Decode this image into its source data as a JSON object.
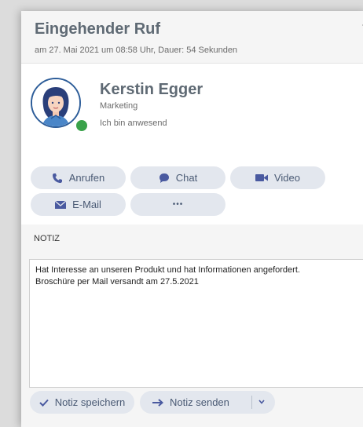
{
  "header": {
    "title": "Eingehender Ruf",
    "subtitle": "am 27. Mai 2021 um 08:58 Uhr, Dauer: 54 Sekunden"
  },
  "contact": {
    "name": "Kerstin Egger",
    "department": "Marketing",
    "status": "Ich bin anwesend",
    "presence_color": "#3aa24a"
  },
  "actions": {
    "call": "Anrufen",
    "chat": "Chat",
    "video": "Video",
    "email": "E-Mail",
    "more": "•••"
  },
  "tabs": {
    "note": "NOTIZ"
  },
  "note": {
    "text": "Hat Interesse an unseren Produkt und hat Informationen angefordert.\nBroschüre per Mail versandt am 27.5.2021"
  },
  "footer": {
    "save": "Notiz speichern",
    "send": "Notiz senden"
  },
  "colors": {
    "button_bg": "#e3e7ee",
    "accent": "#4a5aa0",
    "title": "#5f6a74"
  }
}
